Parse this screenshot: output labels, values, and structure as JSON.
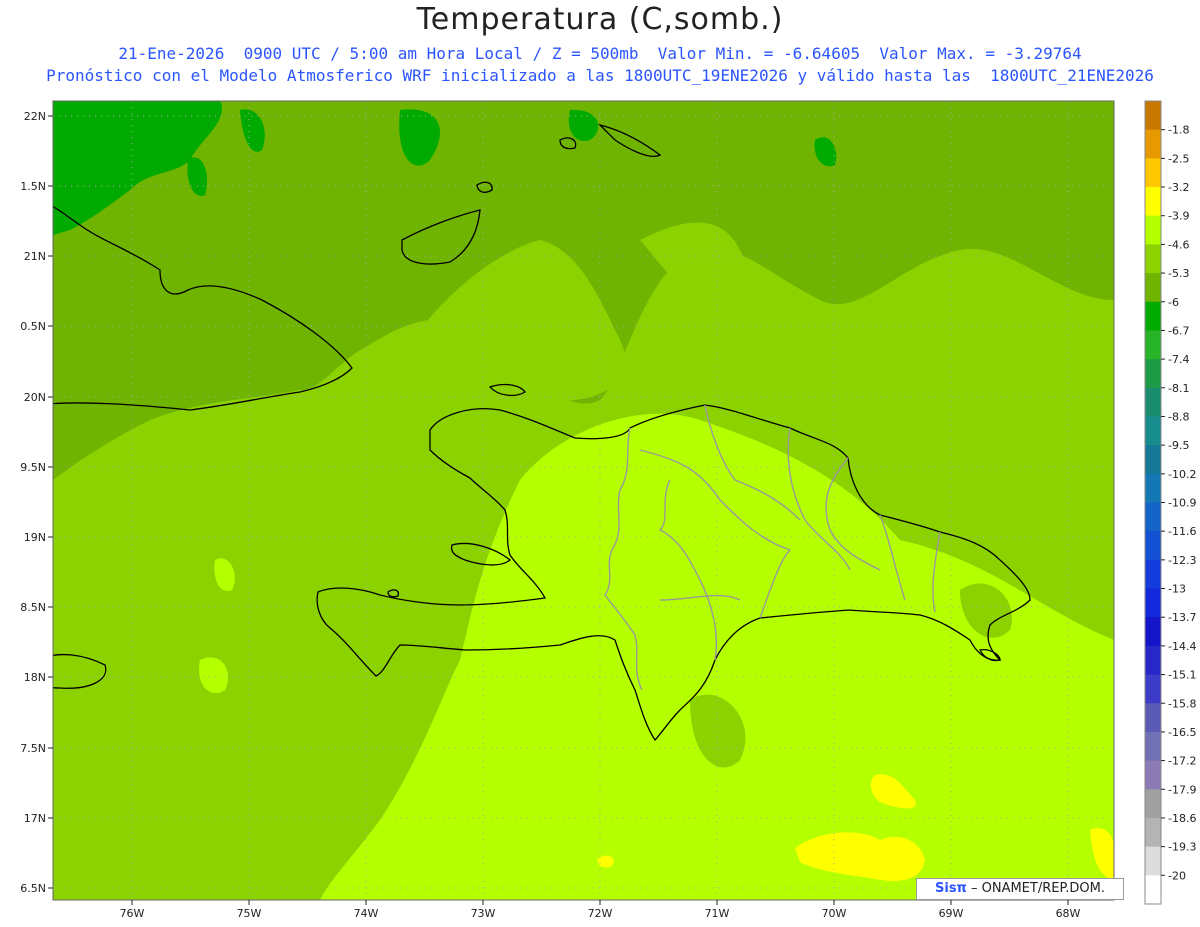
{
  "header": {
    "title": "Temperatura (C,somb.)",
    "line1": "21-Ene-2026  0900 UTC / 5:00 am Hora Local / Z = 500mb  Valor Min. = -6.64605  Valor Max. = -3.29764",
    "line2": "Pronóstico con el Modelo Atmosferico WRF inicializado a las 1800UTC_19ENE2026 y válido hasta las  1800UTC_21ENE2026"
  },
  "axes": {
    "lat_labels": [
      "22N",
      "1.5N",
      "21N",
      "0.5N",
      "20N",
      "9.5N",
      "19N",
      "8.5N",
      "18N",
      "7.5N",
      "17N",
      "6.5N"
    ],
    "lon_labels": [
      "76W",
      "75W",
      "74W",
      "73W",
      "72W",
      "71W",
      "70W",
      "69W",
      "68W"
    ]
  },
  "colorbar": {
    "labels": [
      "-1.8",
      "-2.5",
      "-3.2",
      "-3.9",
      "-4.6",
      "-5.3",
      "-6",
      "-6.7",
      "-7.4",
      "-8.1",
      "-8.8",
      "-9.5",
      "-10.2",
      "-10.9",
      "-11.6",
      "-12.3",
      "-13",
      "-13.7",
      "-14.4",
      "-15.1",
      "-15.8",
      "-16.5",
      "-17.2",
      "-17.9",
      "-18.6",
      "-19.3",
      "-20"
    ],
    "colors": [
      "#c87800",
      "#e69a00",
      "#ffc800",
      "#ffff00",
      "#b4ff00",
      "#8cd200",
      "#6eb400",
      "#00aa00",
      "#28b428",
      "#1e9b46",
      "#1a8c6e",
      "#168c8c",
      "#147896",
      "#1478b4",
      "#1464c8",
      "#1450d2",
      "#143cdc",
      "#1428dc",
      "#1414c8",
      "#2828c8",
      "#3c3cc8",
      "#5a5ab4",
      "#7070b4",
      "#8c7ab4",
      "#a0a0a0",
      "#b4b4b4",
      "#dcdcdc",
      "#ffffff"
    ]
  },
  "watermark": {
    "brand": "Sisπ",
    "text": " – ONAMET/REP.DOM."
  }
}
